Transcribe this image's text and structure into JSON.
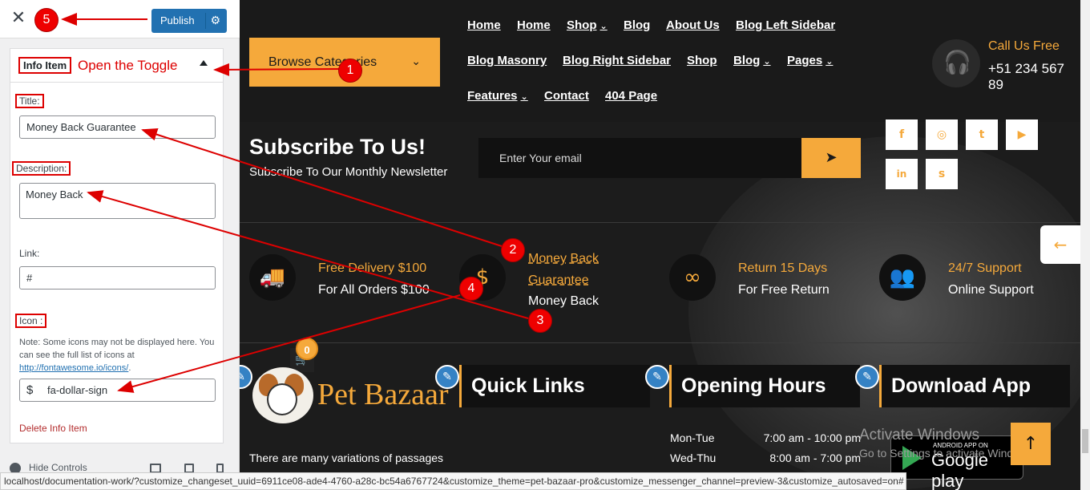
{
  "customizer": {
    "close_label": "✕",
    "publish_label": "Publish",
    "publish_gear": "gear-icon",
    "section_title": "Info Item",
    "title_label": "Title:",
    "title_value": "Money Back Guarantee",
    "description_label": "Description:",
    "description_value": "Money Back",
    "link_label": "Link:",
    "link_value": "#",
    "icon_label": "Icon :",
    "icon_note": "Note: Some icons may not be displayed here. You can see the full list of icons at",
    "icon_link": "http://fontawesome.io/icons/",
    "icon_link_suffix": ".",
    "icon_glyph": "$",
    "icon_value": "fa-dollar-sign",
    "delete_label": "Delete Info Item",
    "hide_controls": "Hide Controls"
  },
  "site": {
    "browse_label": "Browse Categories",
    "nav_rows": [
      [
        {
          "label": "Home",
          "dd": false
        },
        {
          "label": "Home",
          "dd": false
        },
        {
          "label": "Shop",
          "dd": true
        },
        {
          "label": "Blog",
          "dd": false
        },
        {
          "label": "About Us",
          "dd": false
        },
        {
          "label": "Blog Left Sidebar",
          "dd": false
        }
      ],
      [
        {
          "label": "Blog Masonry",
          "dd": false
        },
        {
          "label": "Blog Right Sidebar",
          "dd": false
        },
        {
          "label": "Shop",
          "dd": false
        },
        {
          "label": "Blog",
          "dd": true
        },
        {
          "label": "Pages",
          "dd": true
        }
      ],
      [
        {
          "label": "Features",
          "dd": true
        },
        {
          "label": "Contact",
          "dd": false
        },
        {
          "label": "404 Page",
          "dd": false
        }
      ]
    ],
    "call_label": "Call Us Free",
    "call_number": "+51 234 567 89",
    "subscribe_title": "Subscribe To Us!",
    "subscribe_text": "Subscribe To Our Monthly Newsletter",
    "email_placeholder": "Enter Your email",
    "social": [
      "f",
      "◎",
      "t",
      "▶",
      "in",
      "s"
    ],
    "features": [
      {
        "icon": "🚚",
        "title": "Free Delivery $100",
        "desc": "For All Orders $100"
      },
      {
        "icon": "$",
        "title": "Money Back Guarantee",
        "title_line1": "Money Back",
        "title_line2": "Guarantee",
        "desc": "Money Back"
      },
      {
        "icon": "∞",
        "title": "Return 15 Days",
        "desc": "For Free Return"
      },
      {
        "icon": "👥",
        "title": "24/7 Support",
        "desc": "Online Support"
      }
    ],
    "cart_count": "0",
    "logo_text": "Pet Bazaar",
    "footer_titles": [
      "Quick Links",
      "Opening Hours",
      "Download App"
    ],
    "footer_text": "There are many variations of passages",
    "hours": [
      {
        "day": "Mon-Tue",
        "time": "7:00 am - 10:00 pm"
      },
      {
        "day": "Wed-Thu",
        "time": "8:00 am - 7:00 pm"
      }
    ],
    "gplay_small": "ANDROID APP ON",
    "gplay_big": "Google play",
    "activate_line1": "Activate Windows",
    "activate_line2": "Go to Settings to activate Windows."
  },
  "annotations": {
    "toggle_text": "Open the Toggle",
    "numbers": [
      "1",
      "2",
      "3",
      "4",
      "5"
    ]
  },
  "statusbar": "localhost/documentation-work/?customize_changeset_uuid=6911ce08-ade4-4760-a28c-bc54a6767724&customize_theme=pet-bazaar-pro&customize_messenger_channel=preview-3&customize_autosaved=on#",
  "colors": {
    "accent": "#f5a93b",
    "publish": "#2271b1",
    "annotation": "#dd0000"
  }
}
